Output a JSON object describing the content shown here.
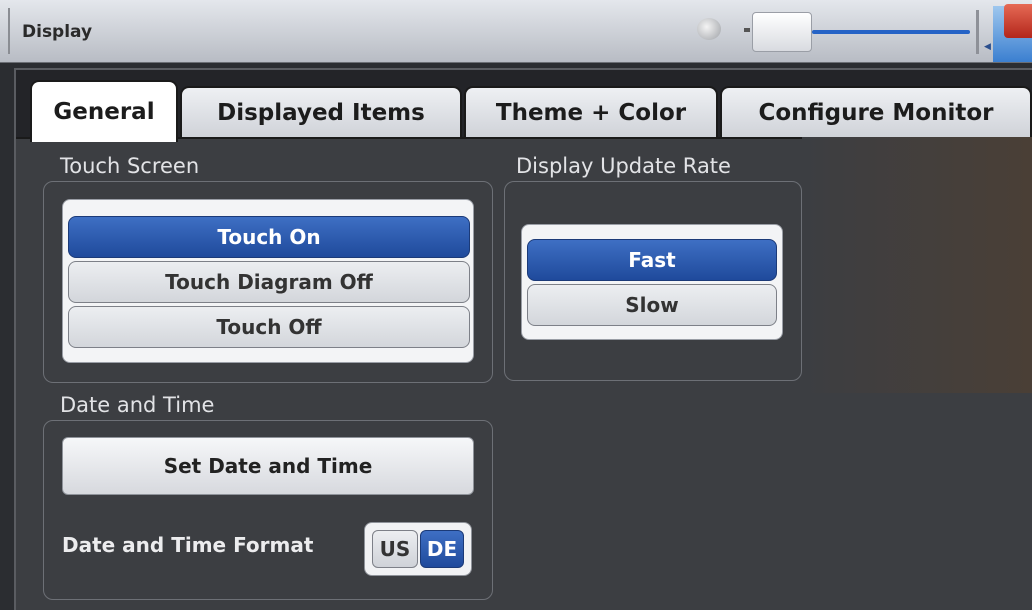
{
  "window": {
    "title": "Display"
  },
  "tabs": [
    {
      "label": "General",
      "active": true
    },
    {
      "label": "Displayed Items",
      "active": false
    },
    {
      "label": "Theme + Color",
      "active": false
    },
    {
      "label": "Configure Monitor",
      "active": false
    }
  ],
  "touch_screen": {
    "label": "Touch Screen",
    "options": [
      "Touch On",
      "Touch Diagram Off",
      "Touch Off"
    ],
    "selected": "Touch On"
  },
  "update_rate": {
    "label": "Display Update Rate",
    "options": [
      "Fast",
      "Slow"
    ],
    "selected": "Fast"
  },
  "date_time": {
    "label": "Date and Time",
    "set_button": "Set Date and Time",
    "format_label": "Date and Time Format",
    "format_options": [
      "US",
      "DE"
    ],
    "format_selected": "DE"
  },
  "colors": {
    "accent": "#2a5bb5",
    "background": "#3c3e42",
    "titlebar": "#cfd2d8"
  }
}
